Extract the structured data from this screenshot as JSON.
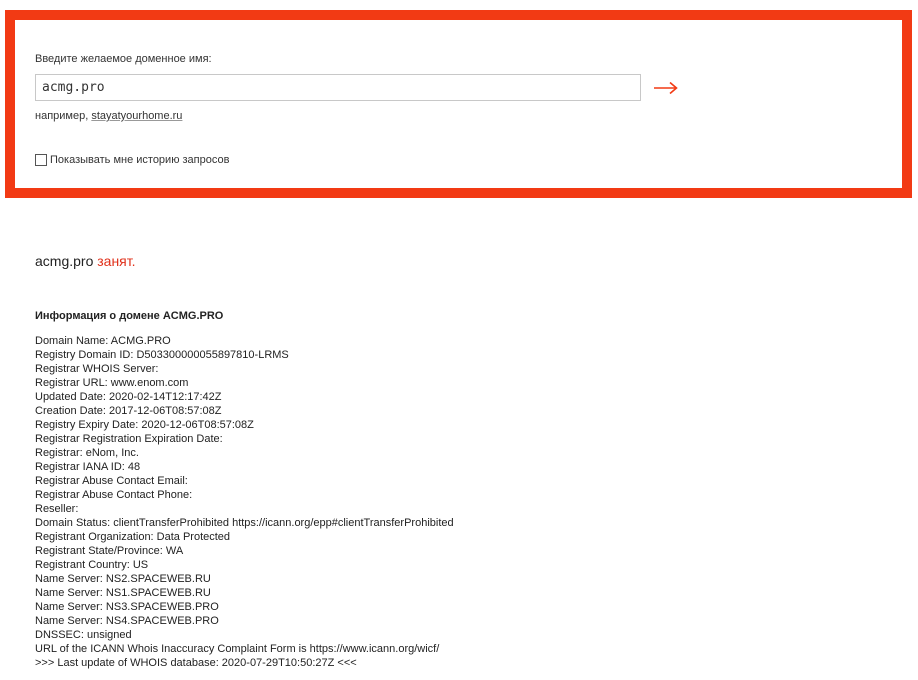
{
  "search": {
    "label": "Введите желаемое доменное имя:",
    "value": "acmg.pro",
    "submit_icon": "arrow-right-icon",
    "example_prefix": "например, ",
    "example_link": "stayatyourhome.ru",
    "history_label": "Показывать мне историю запросов",
    "history_checked": false,
    "accent_color": "#f23a14"
  },
  "result": {
    "domain": "acmg.pro",
    "status": "занят.",
    "status_color": "#e0301a"
  },
  "info": {
    "title": "Информация о домене ACMG.PRO",
    "lines": [
      "Domain Name: ACMG.PRO",
      "Registry Domain ID: D503300000055897810-LRMS",
      "Registrar WHOIS Server:",
      "Registrar URL: www.enom.com",
      "Updated Date: 2020-02-14T12:17:42Z",
      "Creation Date: 2017-12-06T08:57:08Z",
      "Registry Expiry Date: 2020-12-06T08:57:08Z",
      "Registrar Registration Expiration Date:",
      "Registrar: eNom, Inc.",
      "Registrar IANA ID: 48",
      "Registrar Abuse Contact Email:",
      "Registrar Abuse Contact Phone:",
      "Reseller:",
      "Domain Status: clientTransferProhibited https://icann.org/epp#clientTransferProhibited",
      "Registrant Organization: Data Protected",
      "Registrant State/Province: WA",
      "Registrant Country: US",
      "Name Server: NS2.SPACEWEB.RU",
      "Name Server: NS1.SPACEWEB.RU",
      "Name Server: NS3.SPACEWEB.PRO",
      "Name Server: NS4.SPACEWEB.PRO",
      "DNSSEC: unsigned",
      "URL of the ICANN Whois Inaccuracy Complaint Form is https://www.icann.org/wicf/",
      ">>> Last update of WHOIS database: 2020-07-29T10:50:27Z <<<"
    ]
  }
}
